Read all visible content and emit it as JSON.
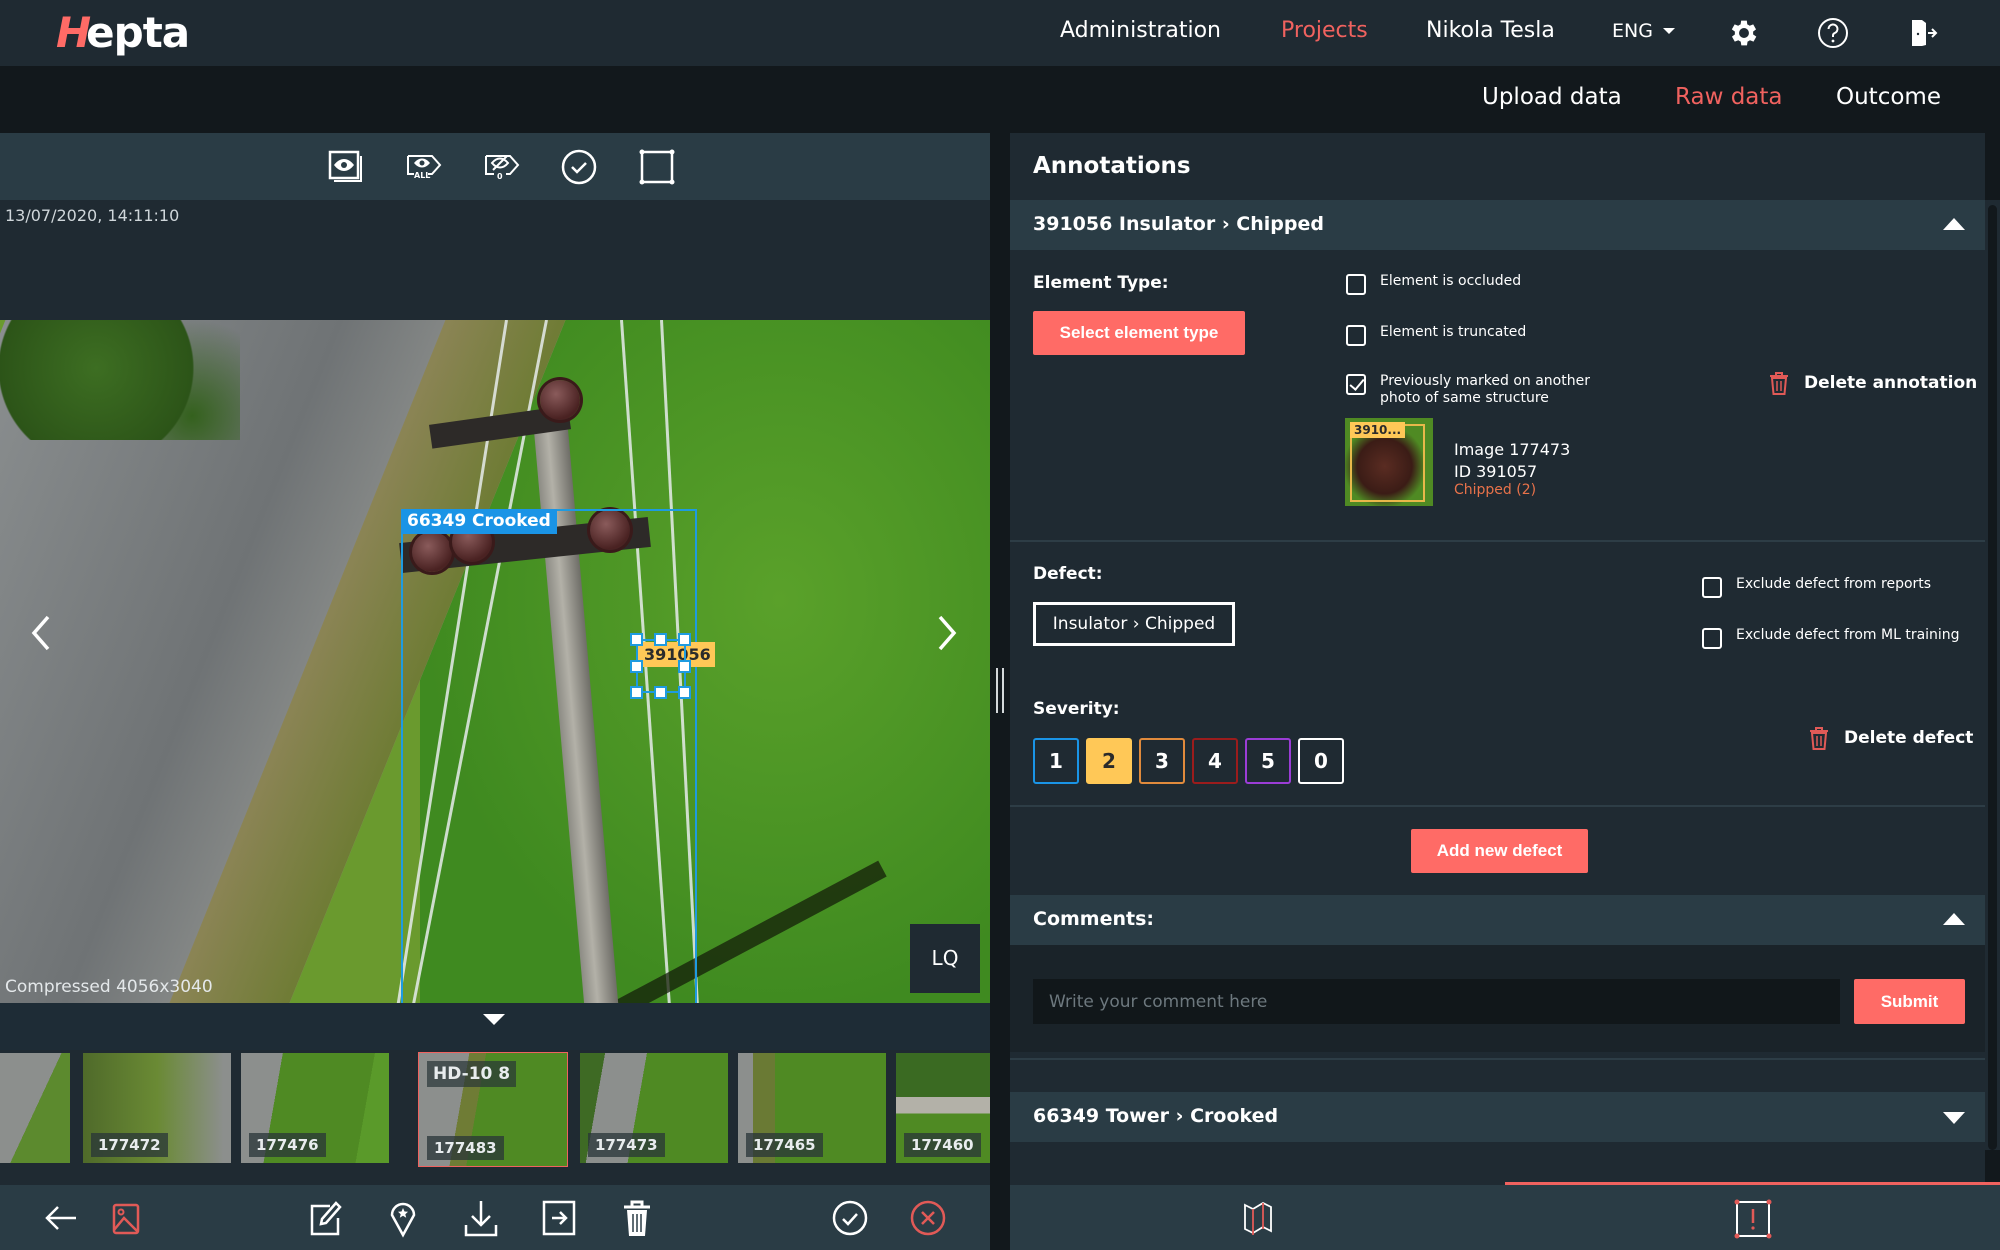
{
  "app": {
    "logo_prefix": "H",
    "logo_rest": "epta"
  },
  "topnav": {
    "items": [
      {
        "label": "Administration",
        "active": false
      },
      {
        "label": "Projects",
        "active": true
      },
      {
        "label": "Nikola Tesla",
        "active": false
      }
    ],
    "language": "ENG",
    "icons": [
      "gear-icon",
      "help-icon",
      "logout-icon"
    ]
  },
  "subnav": {
    "items": [
      {
        "label": "Upload data",
        "active": false
      },
      {
        "label": "Raw data",
        "active": true
      },
      {
        "label": "Outcome",
        "active": false
      }
    ]
  },
  "viewer": {
    "toolbar_icons": [
      "show-image-icon",
      "show-all-labels-icon",
      "hide-labels-icon",
      "approve-icon",
      "draw-box-icon"
    ],
    "toolbar_badges": {
      "all": "ALL",
      "hidden_count": "0"
    },
    "timestamp": "13/07/2020, 14:11:10",
    "annotations": [
      {
        "label": "66349 Crooked",
        "color": "#1a94e6"
      },
      {
        "label": "391056",
        "color": "#ffc857"
      }
    ],
    "quality_button": "LQ",
    "image_info": "Compressed 4056x3040"
  },
  "filmstrip": {
    "thumbnails": [
      {
        "id": "",
        "tag": "",
        "selected": false
      },
      {
        "id": "177472",
        "tag": "",
        "selected": false
      },
      {
        "id": "177476",
        "tag": "",
        "selected": false
      },
      {
        "id": "177483",
        "tag": "HD-10 8",
        "selected": true
      },
      {
        "id": "177473",
        "tag": "",
        "selected": false
      },
      {
        "id": "177465",
        "tag": "",
        "selected": false
      },
      {
        "id": "177460",
        "tag": "",
        "selected": false
      }
    ]
  },
  "bottom_toolbar": {
    "icons": [
      "back-arrow-icon",
      "image-icon",
      "edit-icon",
      "location-pin-icon",
      "download-icon",
      "export-icon",
      "trash-icon",
      "approve-circle-icon",
      "reject-circle-icon"
    ]
  },
  "annotations_panel": {
    "title": "Annotations",
    "active_annotation": {
      "header": "391056 Insulator › Chipped",
      "element_type_label": "Element Type:",
      "select_element_type_button": "Select element type",
      "checkboxes": [
        {
          "label": "Element is occluded",
          "checked": false
        },
        {
          "label": "Element is truncated",
          "checked": false
        },
        {
          "label": "Previously marked on another photo of same structure",
          "checked": true
        }
      ],
      "delete_annotation": "Delete annotation",
      "previous_mark": {
        "thumb_label": "3910...",
        "image": "Image 177473",
        "id": "ID 391057",
        "defect": "Chipped (2)"
      },
      "defect_label": "Defect:",
      "defect_value": "Insulator › Chipped",
      "defect_checkboxes": [
        {
          "label": "Exclude defect from reports",
          "checked": false
        },
        {
          "label": "Exclude defect from ML training",
          "checked": false
        }
      ],
      "severity_label": "Severity:",
      "severity_options": [
        {
          "value": "1",
          "color": "#1a94e6"
        },
        {
          "value": "2",
          "color": "#ffc857"
        },
        {
          "value": "3",
          "color": "#e08a3c"
        },
        {
          "value": "4",
          "color": "#9b1c1c"
        },
        {
          "value": "5",
          "color": "#9b3dd6"
        },
        {
          "value": "0",
          "color": "#ffffff"
        }
      ],
      "selected_severity": "2",
      "delete_defect": "Delete defect",
      "add_defect_button": "Add new defect"
    },
    "comments": {
      "header": "Comments:",
      "placeholder": "Write your comment here",
      "value": "",
      "submit_button": "Submit"
    },
    "other_annotations": [
      {
        "header": "66349 Tower › Crooked"
      }
    ]
  },
  "right_tabs": {
    "items": [
      {
        "icon": "map-icon",
        "active": false
      },
      {
        "icon": "defect-box-icon",
        "active": true
      }
    ]
  },
  "colors": {
    "accent": "#f0625f",
    "button_red": "#ff6b66",
    "bg_dark": "#1f2a32",
    "bg_header": "#2a3c45"
  }
}
